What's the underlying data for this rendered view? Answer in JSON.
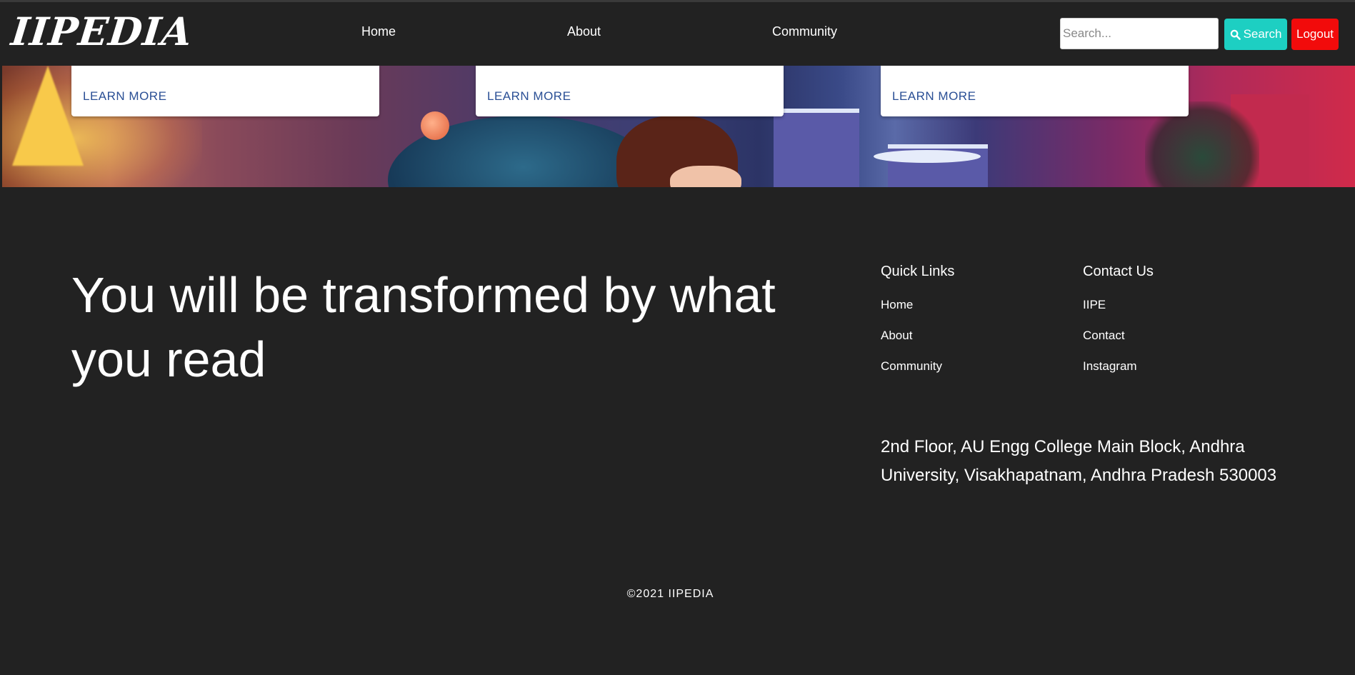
{
  "nav": {
    "brand": "IIPEDIA",
    "links": [
      "Home",
      "About",
      "Community"
    ],
    "search_placeholder": "Search...",
    "search_label": "Search",
    "logout_label": "Logout"
  },
  "cards": [
    {
      "link": "LEARN MORE"
    },
    {
      "link": "LEARN MORE"
    },
    {
      "link": "LEARN MORE"
    }
  ],
  "footer": {
    "quote": "You will be transformed by what you read",
    "quick_links": {
      "title": "Quick Links",
      "items": [
        "Home",
        "About",
        "Community"
      ]
    },
    "contact": {
      "title": "Contact Us",
      "items": [
        "IIPE",
        "Contact",
        "Instagram"
      ]
    },
    "address": "2nd Floor, AU Engg College Main Block, Andhra University, Visakhapatnam, Andhra Pradesh 530003",
    "copyright": "©2021 IIPEDIA"
  },
  "colors": {
    "background": "#222222",
    "search_button": "#1dcfc2",
    "logout_button": "#f20b0b",
    "learn_more": "#2a4f95"
  },
  "icons": [
    "search-icon"
  ]
}
